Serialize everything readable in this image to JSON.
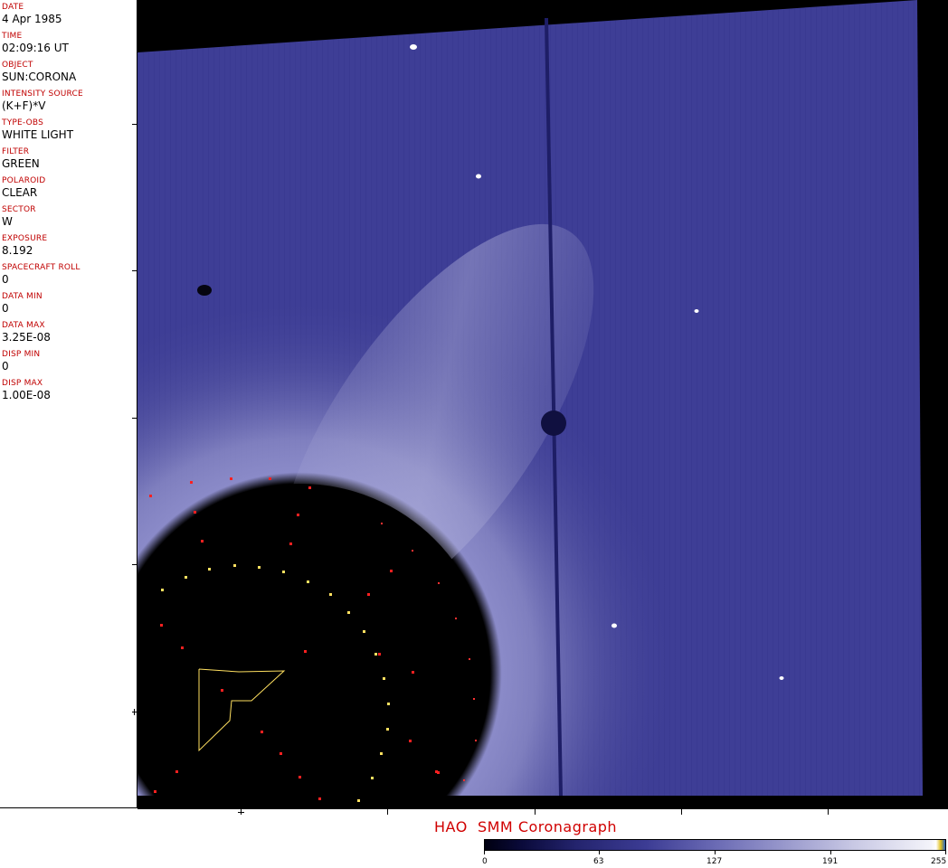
{
  "header_fields": [
    {
      "label": "DATE",
      "value": "4 Apr 1985"
    },
    {
      "label": "TIME",
      "value": "02:09:16 UT"
    },
    {
      "label": "OBJECT",
      "value": "SUN:CORONA"
    },
    {
      "label": "INTENSITY SOURCE",
      "value": "(K+F)*V"
    },
    {
      "label": "TYPE-OBS",
      "value": "WHITE LIGHT"
    },
    {
      "label": "FILTER",
      "value": "GREEN"
    },
    {
      "label": "POLAROID",
      "value": "CLEAR"
    },
    {
      "label": "SECTOR",
      "value": "W"
    },
    {
      "label": "EXPOSURE",
      "value": "8.192"
    },
    {
      "label": "SPACECRAFT ROLL",
      "value": "0"
    },
    {
      "label": "DATA MIN",
      "value": "0"
    },
    {
      "label": "DATA MAX",
      "value": "3.25E-08"
    },
    {
      "label": "DISP MIN",
      "value": "0"
    },
    {
      "label": "DISP MAX",
      "value": "1.00E-08"
    }
  ],
  "title": "HAO  SMM Coronagraph",
  "colorbar": {
    "ticks": [
      "0",
      "63",
      "127",
      "191",
      "255"
    ],
    "colors": {
      "dark": "#000010",
      "mid": "#4a4aa0",
      "light": "#ffffff"
    }
  },
  "colors": {
    "label_red": "#c00000",
    "title_red": "#d00000",
    "corona_blue": "#3e3e96",
    "marker_red": "#ff2020",
    "marker_yellow": "#ffe060"
  }
}
